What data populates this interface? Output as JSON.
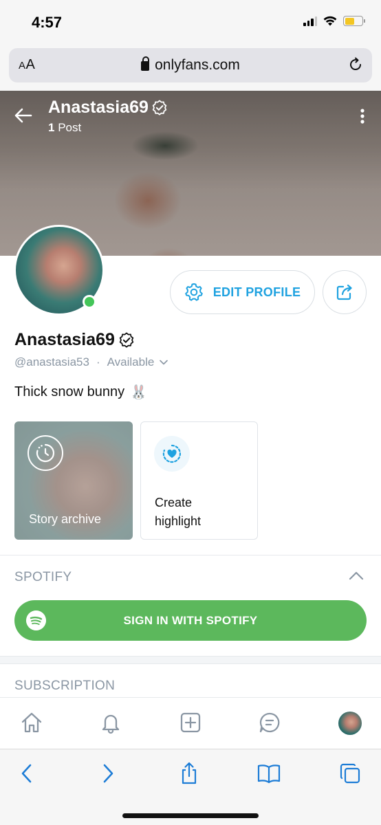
{
  "status_bar": {
    "time": "4:57"
  },
  "browser": {
    "aa_label_small": "A",
    "aa_label_large": "A",
    "url": "onlyfans.com"
  },
  "cover": {
    "name": "Anastasia69",
    "posts_count": "1",
    "posts_label": "Post"
  },
  "profile": {
    "edit_label": "EDIT PROFILE",
    "name": "Anastasia69",
    "handle": "@anastasia53",
    "separator": "·",
    "availability": "Available",
    "bio": "Thick snow bunny",
    "bio_emoji": "🐰",
    "online": true
  },
  "highlights": {
    "archive_label": "Story archive",
    "create_label": "Create highlight"
  },
  "spotify": {
    "title": "SPOTIFY",
    "button_label": "SIGN IN WITH SPOTIFY",
    "brand_color": "#5cb85c"
  },
  "subscription": {
    "title": "SUBSCRIPTION"
  },
  "app_nav": {
    "icons": [
      "home-icon",
      "bell-icon",
      "add-post-icon",
      "messages-icon",
      "profile-avatar"
    ],
    "accent": "#8a96a3"
  },
  "safari_toolbar": {
    "icons": [
      "back-icon",
      "forward-icon",
      "share-icon",
      "bookmarks-icon",
      "tabs-icon"
    ],
    "accent": "#1c7cd6"
  },
  "colors": {
    "link_blue": "#1fa2e0",
    "muted": "#8a96a3",
    "online_green": "#44c559"
  }
}
